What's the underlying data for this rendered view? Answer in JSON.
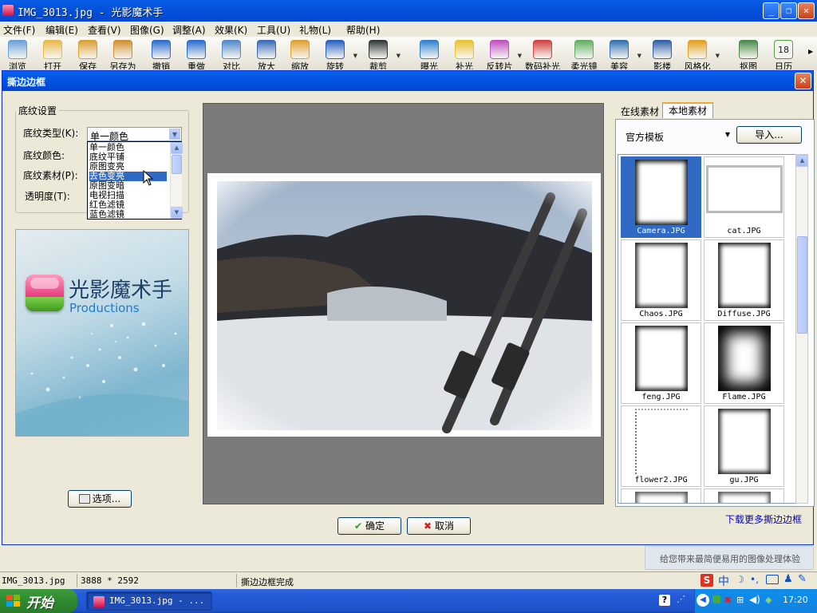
{
  "window": {
    "title": "IMG_3013.jpg - 光影魔术手"
  },
  "menu": [
    "文件(F)",
    "编辑(E)",
    "查看(V)",
    "图像(G)",
    "调整(A)",
    "效果(K)",
    "工具(U)",
    "礼物(L)",
    "帮助(H)"
  ],
  "toolbar": [
    {
      "label": "浏览",
      "icon": "eye-icon",
      "color": "#6aa0d8"
    },
    {
      "label": "打开",
      "icon": "folder-icon",
      "color": "#e8b84a"
    },
    {
      "label": "保存",
      "icon": "save-icon",
      "color": "#d8a030"
    },
    {
      "label": "另存为",
      "icon": "save-as-icon",
      "color": "#d09030"
    },
    {
      "label": "撤销",
      "icon": "undo-icon",
      "color": "#2a6ccc"
    },
    {
      "label": "重做",
      "icon": "redo-icon",
      "color": "#2a6ccc"
    },
    {
      "label": "对比",
      "icon": "compare-icon",
      "color": "#5088c8"
    },
    {
      "label": "放大",
      "icon": "zoom-in-icon",
      "color": "#3a6ab8"
    },
    {
      "label": "缩放",
      "icon": "resize-icon",
      "color": "#e0a030"
    },
    {
      "label": "旋转",
      "icon": "rotate-icon",
      "color": "#2a60c0"
    },
    {
      "label": "裁剪",
      "icon": "crop-icon",
      "color": "#303838"
    },
    {
      "label": "曝光",
      "icon": "sun-icon",
      "color": "#3080d0"
    },
    {
      "label": "补光",
      "icon": "bulb-icon",
      "color": "#e8c030"
    },
    {
      "label": "反转片",
      "icon": "film-icon",
      "color": "#c050c0"
    },
    {
      "label": "数码补光",
      "icon": "magnify-color-icon",
      "color": "#d04040"
    },
    {
      "label": "柔光镜",
      "icon": "landscape-icon",
      "color": "#60b060"
    },
    {
      "label": "美容",
      "icon": "face-icon",
      "color": "#3070b0"
    },
    {
      "label": "影楼",
      "icon": "studio-icon",
      "color": "#3060a8"
    },
    {
      "label": "风格化",
      "icon": "style-icon",
      "color": "#e0a020"
    },
    {
      "label": "抠图",
      "icon": "cutout-icon",
      "color": "#4a8a4a"
    },
    {
      "label": "日历",
      "icon": "calendar-icon",
      "color": "#5a9a40",
      "text": "18"
    }
  ],
  "dialog": {
    "title": "撕边边框",
    "group_title": "底纹设置",
    "labels": {
      "type": "底纹类型(K):",
      "color": "底纹颜色:",
      "material": "底纹素材(P):",
      "opacity": "透明度(T):"
    },
    "type_value": "单一颜色",
    "dropdown_options": [
      "单一颜色",
      "底纹平铺",
      "原图变亮",
      "去色变亮",
      "原图变暗",
      "电视扫描",
      "红色滤镜",
      "蓝色滤镜"
    ],
    "dropdown_selected": 3,
    "banner": {
      "brand": "光影魔术手",
      "sub": "Productions"
    },
    "options_button": "选项...",
    "ok_button": "确定",
    "cancel_button": "取消",
    "tabs": [
      "在线素材",
      "本地素材"
    ],
    "active_tab": 1,
    "template_select": "官方模板",
    "import_button": "导入...",
    "thumbnails": [
      "Camera.JPG",
      "cat.JPG",
      "Chaos.JPG",
      "Diffuse.JPG",
      "feng.JPG",
      "Flame.JPG",
      "flower2.JPG",
      "gu.JPG",
      "",
      ""
    ],
    "download_link": "下载更多撕边边框"
  },
  "side_ad": "给您带来最简便易用的图像处理体验",
  "status": {
    "file": "IMG_3013.jpg",
    "size": "3888 * 2592",
    "message": "撕边边框完成"
  },
  "taskbar": {
    "start": "开始",
    "task": "IMG_3013.jpg - ...",
    "clock": "17:20",
    "ime": "中"
  }
}
